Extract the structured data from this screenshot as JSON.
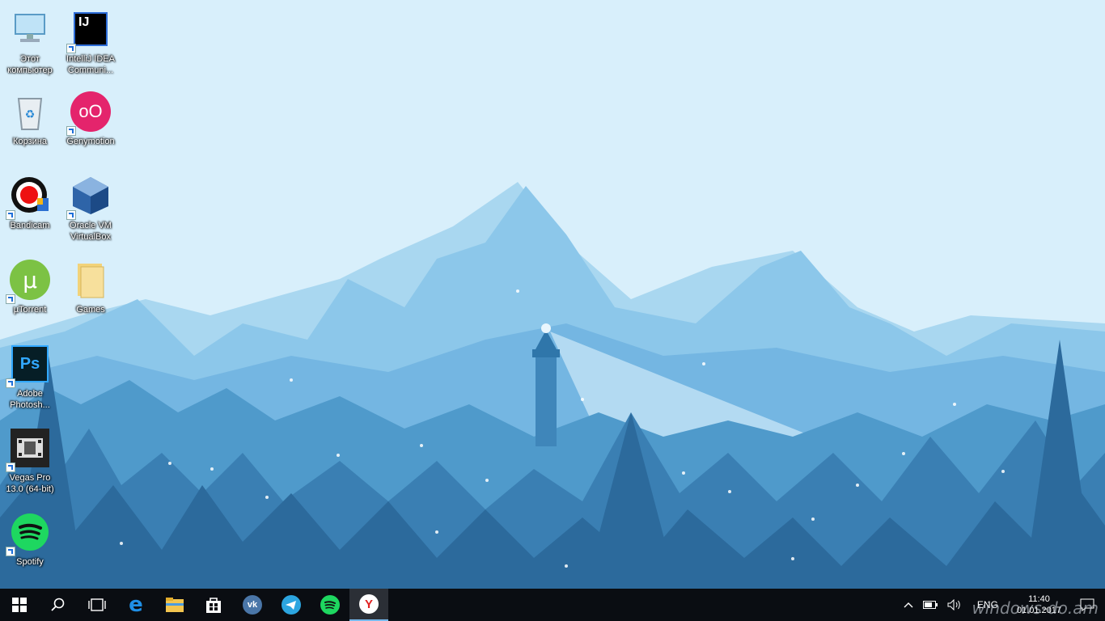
{
  "desktop": {
    "icons": [
      {
        "label": "Этот компьютер",
        "icon": "computer-icon"
      },
      {
        "label": "IntelliJ IDEA Communi...",
        "icon": "intellij-icon"
      },
      {
        "label": "Корзина",
        "icon": "recycle-bin-icon"
      },
      {
        "label": "Genymotion",
        "icon": "genymotion-icon"
      },
      {
        "label": "Bandicam",
        "icon": "bandicam-icon"
      },
      {
        "label": "Oracle VM VirtualBox",
        "icon": "virtualbox-icon"
      },
      {
        "label": "µTorrent",
        "icon": "utorrent-icon"
      },
      {
        "label": "Games",
        "icon": "folder-icon"
      },
      {
        "label": "Adobe Photosh...",
        "icon": "photoshop-icon"
      },
      {
        "label": "Vegas Pro 13.0 (64-bit)",
        "icon": "vegas-icon"
      },
      {
        "label": "Spotify",
        "icon": "spotify-icon"
      }
    ],
    "icon_text": {
      "intellij": "IJ",
      "photoshop": "Ps",
      "genymotion": "oO"
    }
  },
  "taskbar": {
    "buttons": [
      {
        "name": "start",
        "icon": "windows-icon"
      },
      {
        "name": "search",
        "icon": "search-icon"
      },
      {
        "name": "task-view",
        "icon": "task-view-icon"
      },
      {
        "name": "edge",
        "icon": "edge-icon"
      },
      {
        "name": "explorer",
        "icon": "folder-icon"
      },
      {
        "name": "store",
        "icon": "store-icon"
      },
      {
        "name": "vk",
        "icon": "vk-icon"
      },
      {
        "name": "telegram",
        "icon": "telegram-icon"
      },
      {
        "name": "spotify",
        "icon": "spotify-icon"
      },
      {
        "name": "yandex-browser",
        "icon": "yandex-icon",
        "active": true
      }
    ],
    "tray": {
      "language": "ENG",
      "time": "11:40",
      "date": "01.01.2017"
    },
    "vk_text": "vk",
    "yandex_text": "Y",
    "edge_text": "e"
  },
  "watermark": "windows-do.am",
  "colors": {
    "sky": "#d6eefb",
    "taskbar": "#0a0d12",
    "accent": "#76b9ed"
  }
}
